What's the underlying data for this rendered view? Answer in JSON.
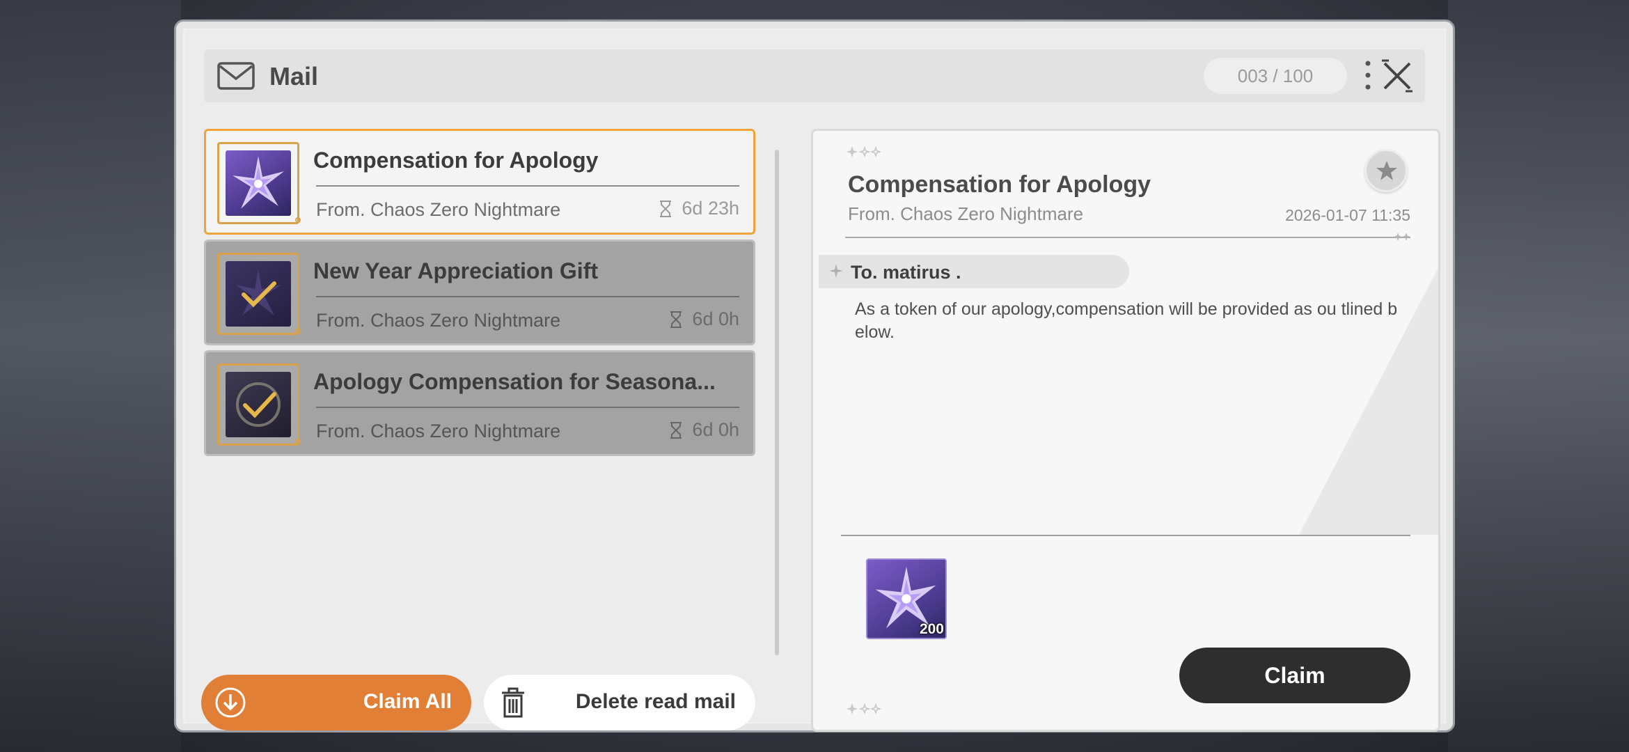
{
  "header": {
    "title": "Mail",
    "count": "003 / 100"
  },
  "mails": [
    {
      "title": "Compensation for Apology",
      "from": "From. Chaos Zero Nightmare",
      "time_left": "6d 23h",
      "icon": "crystal-star-icon",
      "claimed": false
    },
    {
      "title": "New Year Appreciation Gift",
      "from": "From. Chaos Zero Nightmare",
      "time_left": "6d 0h",
      "icon": "check-icon",
      "claimed": true
    },
    {
      "title": "Apology Compensation for Seasona...",
      "from": "From. Chaos Zero Nightmare",
      "time_left": "6d 0h",
      "icon": "check-icon",
      "claimed": true
    }
  ],
  "footer": {
    "claim_all": "Claim All",
    "delete_read": "Delete read mail"
  },
  "detail": {
    "title": "Compensation for Apology",
    "from": "From. Chaos Zero Nightmare",
    "date": "2026-01-07 11:35",
    "to": "To. matirus .",
    "body": "As a token of our apology,compensation will be provided as ou tlined below.",
    "reward": {
      "icon": "crystal-star-icon",
      "quantity": "200"
    },
    "claim": "Claim"
  },
  "colors": {
    "accent_orange": "#e17f37",
    "selected_border": "#f0a43a",
    "claim_button": "#2e2e2e"
  }
}
